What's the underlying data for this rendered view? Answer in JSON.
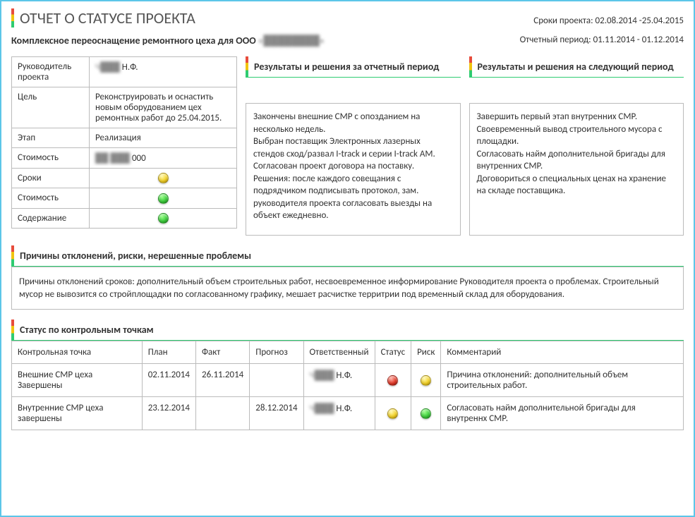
{
  "header": {
    "title": "ОТЧЕТ О СТАТУСЕ ПРОЕКТА",
    "project_dates_label": "Сроки проекта: 02.08.2014 -25.04.2015",
    "subtitle_prefix": "Комплексное переоснащение ремонтного цеха для ООО ",
    "subtitle_blur": "«████████»",
    "report_period_label": "Отчетный период: 01.11.2014 - 01.12.2014"
  },
  "info": {
    "rows": [
      {
        "label": "Руководитель проекта",
        "value_blur": "Ч███",
        "value_suffix": " Н.Ф."
      },
      {
        "label": "Цель",
        "value": "Реконструировать и оснастить новым оборудованием цех ремонтных работ до 25.04.2015."
      },
      {
        "label": "Этап",
        "value": "Реализация"
      },
      {
        "label": "Стоимость",
        "value_blur": "██ ███",
        "value_suffix": " 000"
      },
      {
        "label": "Сроки",
        "dot": "yellow"
      },
      {
        "label": "Стоимость",
        "dot": "green"
      },
      {
        "label": "Содержание",
        "dot": "green"
      }
    ]
  },
  "results_current": {
    "title": "Результаты и решения за отчетный период",
    "text": "Закончены внешние СМР с опозданием на несколько недель.\nВыбран поставщик Электронных лазерных стендов сход/развал I-track и серии  I-track AM. Согласован проект договора на поставку.\nРешения: после каждого совещания с подрядчиком подписывать протокол, зам. руководителя проекта согласовать выезды на объект ежедневно."
  },
  "results_next": {
    "title": "Результаты и решения на следующий период",
    "text": "Завершить первый этап внутренних СМР. Своевременный вывод строительного мусора с площадки.\nСогласовать найм дополнительной бригады для внутренних СМР.\nДоговориться о специальных ценах на хранение на складе поставщика."
  },
  "deviations": {
    "title": "Причины отклонений, риски, нерешенные проблемы",
    "text": "Причины отклонений сроков: дополнительный объем строительных работ, несвоевременное информирование Руководителя проекта о проблемах. Строительный мусор не вывозится со стройплощадки по согласованному графику, мешает расчистке территрии под временный склад для оборудования."
  },
  "milestones": {
    "title": "Статус по контрольным точкам",
    "columns": [
      "Контрольная точка",
      "План",
      "Факт",
      "Прогноз",
      "Ответственный",
      "Статус",
      "Риск",
      "Комментарий"
    ],
    "rows": [
      {
        "name": "Внешние СМР цеха Завершены",
        "plan": "02.11.2014",
        "fact": "26.11.2014",
        "forecast": "",
        "owner_blur": "Ч███",
        "owner_suffix": " Н.Ф.",
        "status": "red",
        "risk": "yellow",
        "comment": "Причина отклонений: дополнительный объем строительных работ."
      },
      {
        "name": "Внутренние СМР цеха завершены",
        "plan": "23.12.2014",
        "fact": "",
        "forecast": "28.12.2014",
        "owner_blur": "Ч███",
        "owner_suffix": " Н.Ф.",
        "status": "yellow",
        "risk": "green",
        "comment": "Согласовать найм дополнительной бригады для внутреннх СМР."
      }
    ]
  }
}
